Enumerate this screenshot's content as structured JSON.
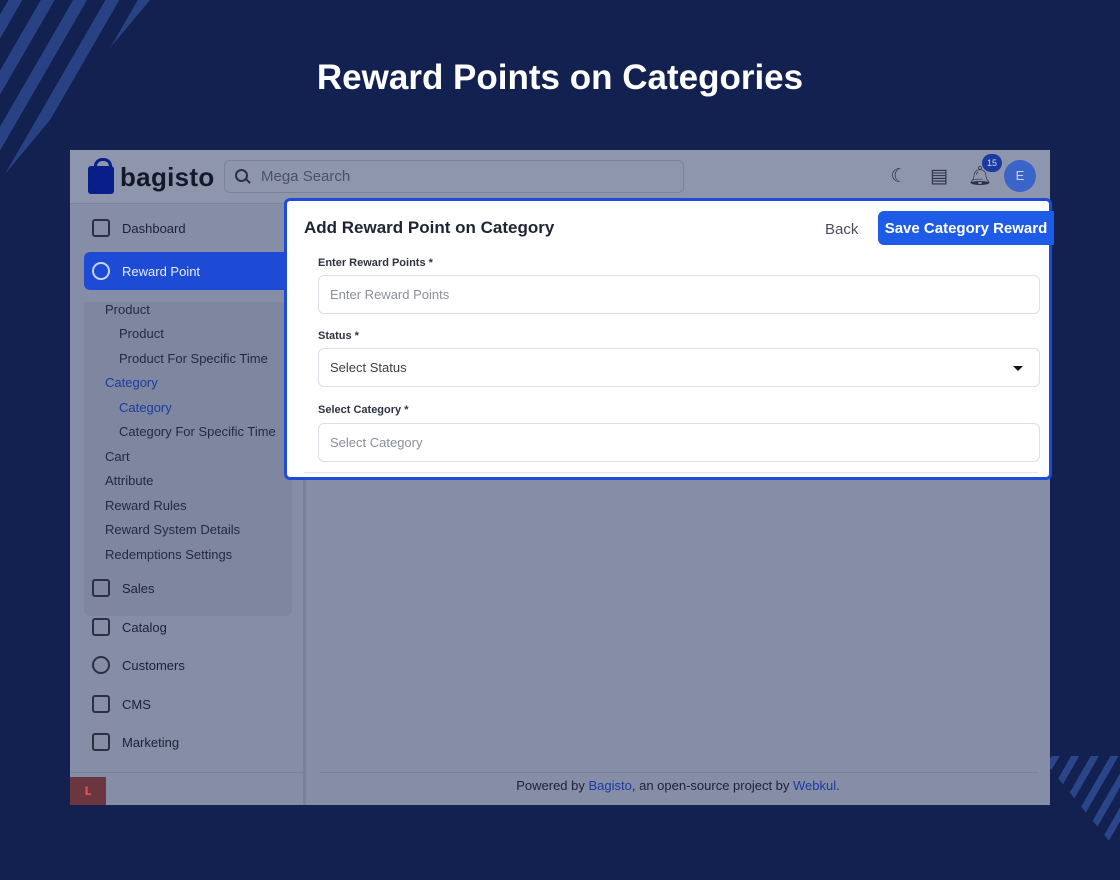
{
  "headline": "Reward Points on Categories",
  "brand": {
    "logo_text": "bagisto"
  },
  "search": {
    "placeholder": "Mega Search"
  },
  "topbar": {
    "notification_count": "15",
    "avatar_initial": "E"
  },
  "sidebar": {
    "items": [
      {
        "label": "Dashboard"
      },
      {
        "label": "Reward Point"
      },
      {
        "label": "Sales"
      },
      {
        "label": "Catalog"
      },
      {
        "label": "Customers"
      },
      {
        "label": "CMS"
      },
      {
        "label": "Marketing"
      }
    ],
    "reward_submenu": [
      {
        "label": "Product"
      },
      {
        "label": "Product"
      },
      {
        "label": "Product For Specific Time"
      },
      {
        "label": "Category"
      },
      {
        "label": "Category"
      },
      {
        "label": "Category For Specific Time"
      },
      {
        "label": "Cart"
      },
      {
        "label": "Attribute"
      },
      {
        "label": "Reward Rules"
      },
      {
        "label": "Reward System Details"
      },
      {
        "label": "Redemptions Settings"
      }
    ]
  },
  "modal": {
    "title": "Add Reward Point on Category",
    "back_label": "Back",
    "save_label": "Save Category Reward",
    "reward_points": {
      "label": "Enter Reward Points *",
      "placeholder": "Enter Reward Points"
    },
    "status": {
      "label": "Status *",
      "value": "Select Status"
    },
    "category": {
      "label": "Select Category *",
      "value": "Select Category"
    }
  },
  "footer": {
    "prefix": "Powered by ",
    "link1": "Bagisto",
    "middle": ", an open-source project by ",
    "link2": "Webkul",
    "suffix": "."
  },
  "colors": {
    "background": "#132150",
    "accent": "#1e5be6",
    "active_nav": "#1d4bd6"
  }
}
